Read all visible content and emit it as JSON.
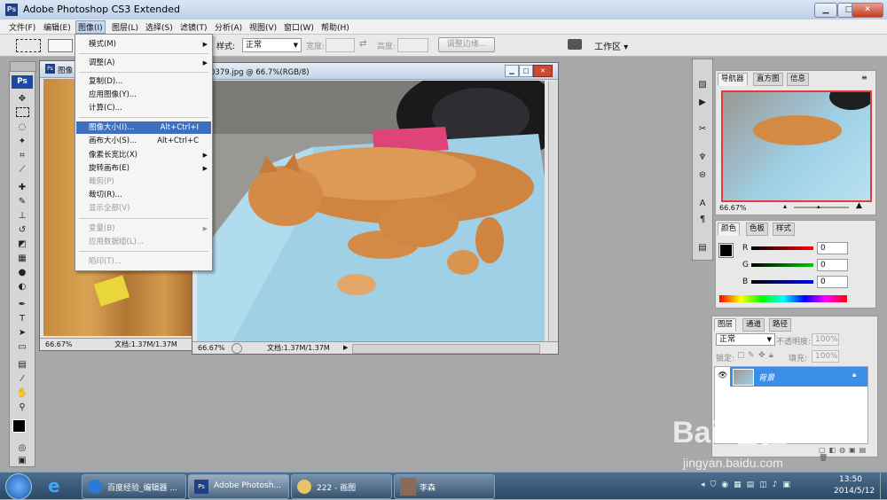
{
  "app": {
    "title": "Adobe Photoshop CS3 Extended",
    "ps_logo": "Ps",
    "window_buttons": [
      "minimize-icon",
      "maximize-icon",
      "close-icon"
    ]
  },
  "menubar": [
    "文件(F)",
    "编辑(E)",
    "图像(I)",
    "图层(L)",
    "选择(S)",
    "滤镜(T)",
    "分析(A)",
    "视图(V)",
    "窗口(W)",
    "帮助(H)"
  ],
  "options_bar": {
    "style_label": "样式:",
    "style_value": "正常",
    "width_label": "宽度:",
    "height_label": "高度:",
    "refine_edge": "调整边缘...",
    "workspace": "工作区 ▾"
  },
  "dropdown": {
    "items": [
      {
        "label": "模式(M)",
        "submenu": true,
        "disabled": false
      },
      {
        "label": "调整(A)",
        "submenu": true,
        "disabled": false
      },
      {
        "label": "复制(D)...",
        "disabled": false
      },
      {
        "label": "应用图像(Y)...",
        "disabled": false
      },
      {
        "label": "计算(C)...",
        "disabled": false
      },
      {
        "label": "图像大小(I)...",
        "shortcut": "Alt+Ctrl+I",
        "disabled": false,
        "highlighted": true
      },
      {
        "label": "画布大小(S)...",
        "shortcut": "Alt+Ctrl+C",
        "disabled": false
      },
      {
        "label": "像素长宽比(X)",
        "submenu": true,
        "disabled": false
      },
      {
        "label": "旋转画布(E)",
        "submenu": true,
        "disabled": false
      },
      {
        "label": "裁剪(P)",
        "disabled": true
      },
      {
        "label": "裁切(R)...",
        "disabled": false
      },
      {
        "label": "显示全部(V)",
        "disabled": true
      },
      {
        "label": "变量(B)",
        "submenu": true,
        "disabled": true
      },
      {
        "label": "应用数据组(L)...",
        "disabled": true
      },
      {
        "label": "陷印(T)...",
        "disabled": true
      }
    ]
  },
  "doc_back": {
    "title": "图像",
    "zoom": "66.67%",
    "doc_info": "文档:1.37M/1.37M"
  },
  "doc_front": {
    "title": "图像0379.jpg @ 66.7%(RGB/8)",
    "zoom": "66.67%",
    "doc_info": "文档:1.37M/1.37M"
  },
  "navigator": {
    "tabs": [
      "导航器",
      "直方图",
      "信息"
    ],
    "zoom": "66.67%"
  },
  "color_panel": {
    "tabs": [
      "颜色",
      "色板",
      "样式"
    ],
    "r_label": "R",
    "g_label": "G",
    "b_label": "B",
    "r": "0",
    "g": "0",
    "b": "0"
  },
  "layers_panel": {
    "tabs": [
      "图层",
      "通道",
      "路径"
    ],
    "blend_mode": "正常",
    "opacity_label": "不透明度:",
    "opacity": "100%",
    "lock_label": "锁定:",
    "fill_label": "填充:",
    "fill": "100%",
    "layer_name": "背景"
  },
  "watermark": {
    "brand": "Bai  经验",
    "url": "jingyan.baidu.com"
  },
  "taskbar": {
    "tasks": [
      "百度经验_编辑器 ...",
      "Adobe Photosh...",
      "222 - 画图",
      "李森"
    ],
    "time": "13:50",
    "date": "2014/5/12"
  },
  "colors": {
    "titlebar": "#c9d8ec",
    "highlight": "#3d6fbe",
    "layer_selected": "#3b8ee6",
    "taskbar": "#365677"
  }
}
